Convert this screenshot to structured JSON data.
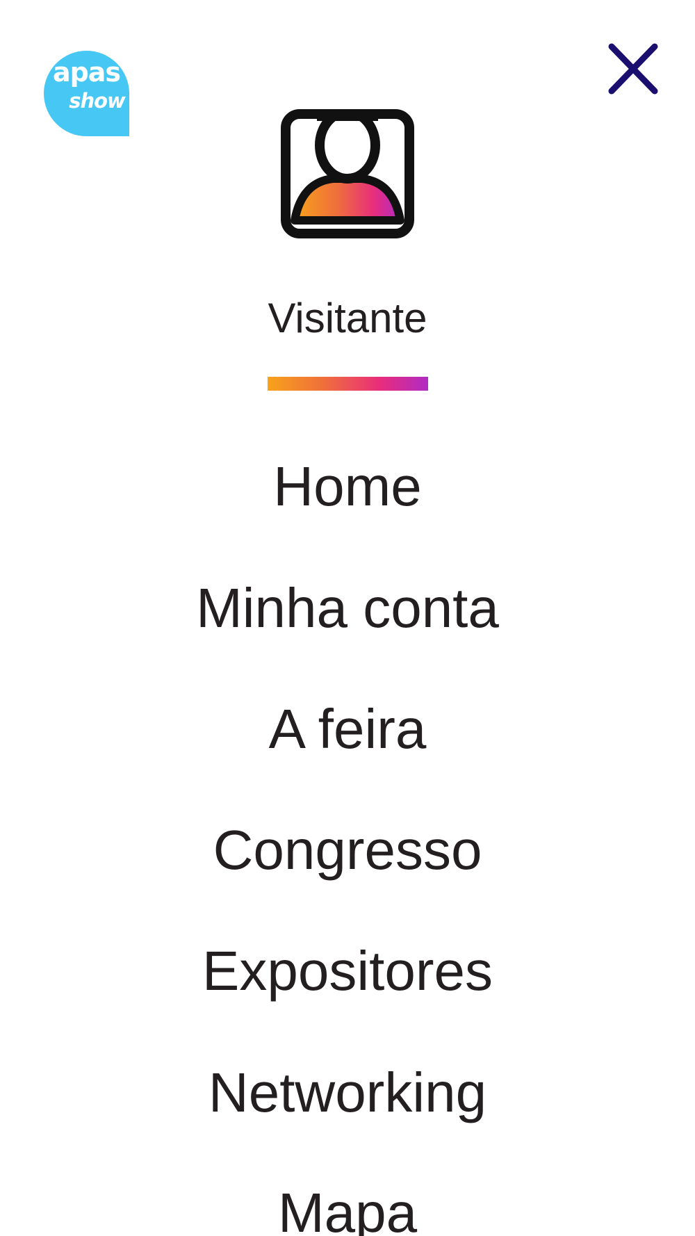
{
  "brand": {
    "logo_line1": "apas",
    "logo_line2": "show",
    "logo_color": "#47c8f4"
  },
  "header": {
    "close_icon": "close-icon",
    "close_color": "#1a0f6e"
  },
  "user": {
    "avatar_icon": "user-profile-icon",
    "name": "Visitante",
    "accent_gradient": [
      "#f7a21b",
      "#ef6f3b",
      "#e82d7c",
      "#b02bc4"
    ]
  },
  "menu": {
    "items": [
      {
        "label": "Home"
      },
      {
        "label": "Minha conta"
      },
      {
        "label": "A feira"
      },
      {
        "label": "Congresso"
      },
      {
        "label": "Expositores"
      },
      {
        "label": "Networking"
      },
      {
        "label": "Mapa"
      }
    ]
  }
}
